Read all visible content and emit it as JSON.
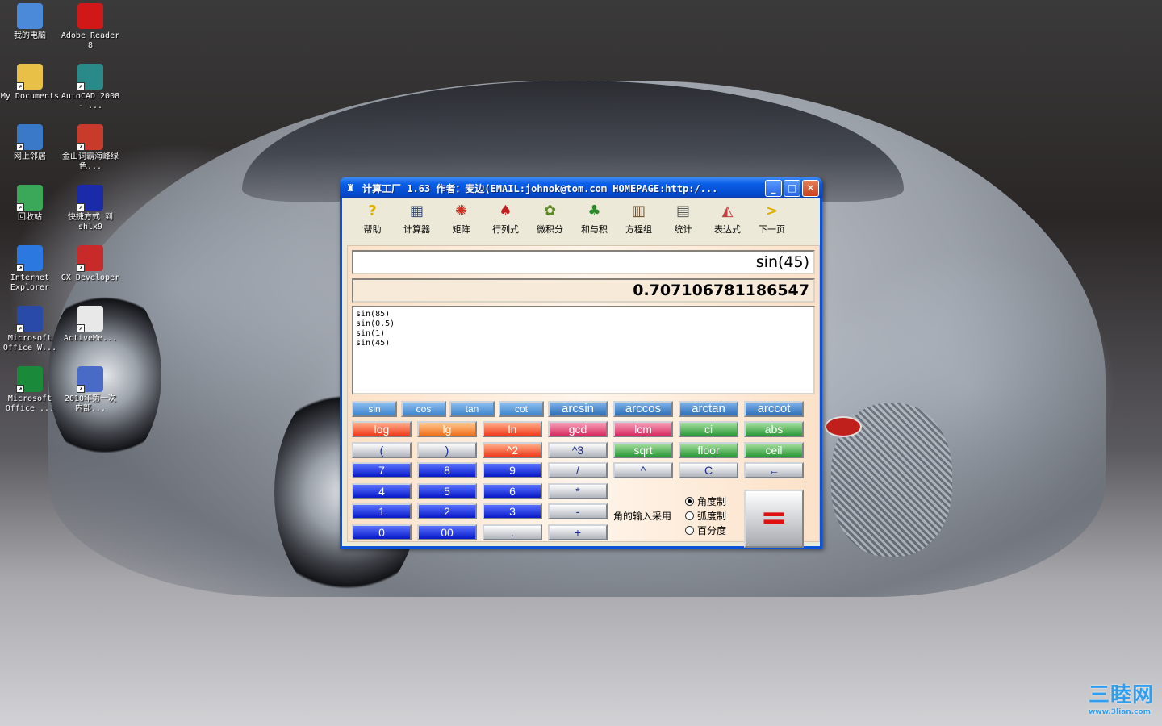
{
  "desktop": {
    "icons": [
      {
        "label": "我的电脑",
        "icon": "computer-icon",
        "color": "#4a8ad8"
      },
      {
        "label": "Adobe Reader 8",
        "icon": "adobe-reader-icon",
        "color": "#d01818"
      },
      {
        "label": "My Documents",
        "icon": "folder-icon",
        "color": "#e8c048"
      },
      {
        "label": "AutoCAD 2008 - ...",
        "icon": "autocad-icon",
        "color": "#2a8a8a"
      },
      {
        "label": "网上邻居",
        "icon": "network-icon",
        "color": "#3a78c8"
      },
      {
        "label": "金山词霸海峰绿色...",
        "icon": "dictionary-icon",
        "color": "#c83a2a"
      },
      {
        "label": "回收站",
        "icon": "recycle-bin-icon",
        "color": "#3aa858"
      },
      {
        "label": "快捷方式 到 shlx9",
        "icon": "shortcut-icon",
        "color": "#1a2aa8"
      },
      {
        "label": "Internet Explorer",
        "icon": "ie-icon",
        "color": "#2a78e0"
      },
      {
        "label": "GX Developer",
        "icon": "gx-developer-icon",
        "color": "#c82a2a"
      },
      {
        "label": "Microsoft Office W...",
        "icon": "word-icon",
        "color": "#2a4aa8"
      },
      {
        "label": "ActiveMe...",
        "icon": "activeme-icon",
        "color": "#e8e8e8"
      },
      {
        "label": "Microsoft Office ...",
        "icon": "excel-icon",
        "color": "#1a8a3a"
      },
      {
        "label": "2010年第一次内部...",
        "icon": "document-icon",
        "color": "#4a6ac8"
      }
    ]
  },
  "window": {
    "title": "计算工厂 1.63 作者：麦边(EMAIL:johnok@tom.com HOMEPAGE:http:/...",
    "minimize": "_",
    "maximize": "□",
    "close": "✕"
  },
  "toolbar": [
    {
      "label": "帮助",
      "icon": "help-icon",
      "glyph": "?",
      "color": "#e0b000"
    },
    {
      "label": "计算器",
      "icon": "calculator-icon",
      "glyph": "▦",
      "color": "#3a4a6a"
    },
    {
      "label": "矩阵",
      "icon": "matrix-icon",
      "glyph": "✺",
      "color": "#d03020"
    },
    {
      "label": "行列式",
      "icon": "determinant-icon",
      "glyph": "♠",
      "color": "#c02020"
    },
    {
      "label": "微积分",
      "icon": "calculus-icon",
      "glyph": "✿",
      "color": "#5a8a20"
    },
    {
      "label": "和与积",
      "icon": "sum-product-icon",
      "glyph": "♣",
      "color": "#2a8a2a"
    },
    {
      "label": "方程组",
      "icon": "equations-icon",
      "glyph": "▥",
      "color": "#6a4a2a"
    },
    {
      "label": "统计",
      "icon": "statistics-icon",
      "glyph": "▤",
      "color": "#5a5a5a"
    },
    {
      "label": "表达式",
      "icon": "expression-icon",
      "glyph": "◭",
      "color": "#c04040"
    },
    {
      "label": "下一页",
      "icon": "next-page-icon",
      "glyph": ">",
      "color": "#e0b000"
    }
  ],
  "display": {
    "input": "sin(45)",
    "result": "0.707106781186547",
    "history": [
      "sin(85)",
      "sin(0.5)",
      "sin(1)",
      "sin(45)"
    ]
  },
  "keys": [
    [
      "sin",
      "cos",
      "tan",
      "cot",
      "arcsin",
      "arccos",
      "arctan",
      "arccot"
    ],
    [
      "log",
      "lg",
      "ln",
      "gcd",
      "lcm",
      "ci",
      "abs"
    ],
    [
      "(",
      ")",
      "^2",
      "^3",
      "sqrt",
      "floor",
      "ceil"
    ],
    [
      "7",
      "8",
      "9",
      "/",
      "^",
      "C",
      "←"
    ],
    [
      "4",
      "5",
      "6",
      "*"
    ],
    [
      "1",
      "2",
      "3",
      "-"
    ],
    [
      "0",
      "00",
      ".",
      "+"
    ]
  ],
  "equals": "=",
  "angle": {
    "label": "角的输入采用",
    "options": [
      "角度制",
      "弧度制",
      "百分度"
    ],
    "selected": 0
  },
  "watermark": {
    "main": "三睦网",
    "sub": "www.3lian.com"
  }
}
